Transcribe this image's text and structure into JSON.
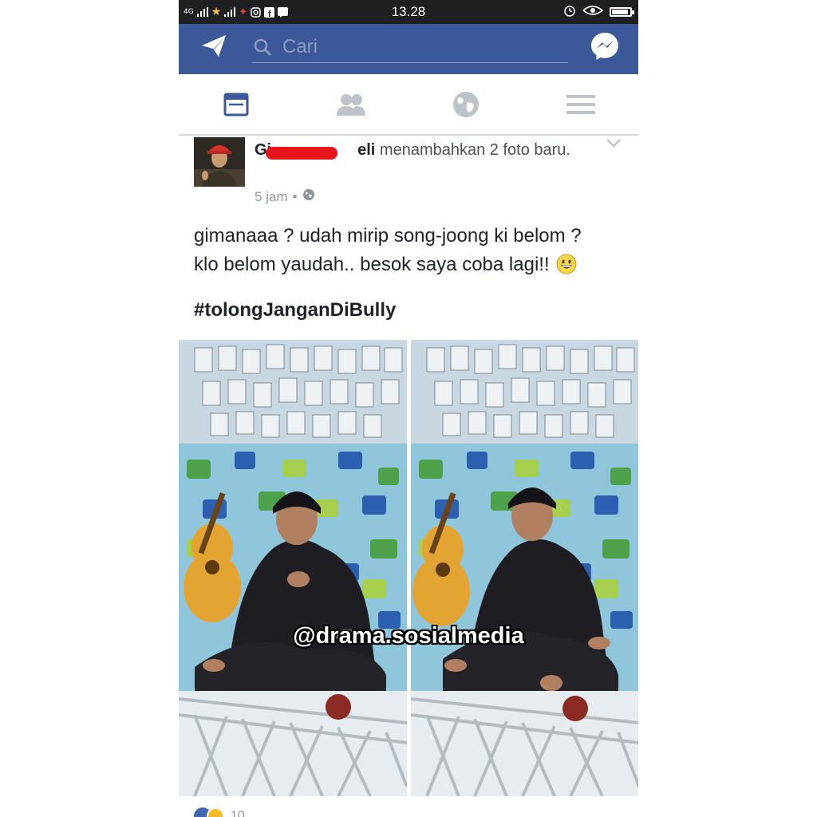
{
  "status_bar": {
    "network_label": "4G",
    "time": "13.28",
    "battery_level": 0.9
  },
  "navbar": {
    "search_placeholder": "Cari",
    "left_icon": "send-icon",
    "right_icon": "messenger-icon",
    "color": "#3b5998"
  },
  "tabs": [
    {
      "name": "news-feed",
      "icon": "newsfeed-icon",
      "active": true
    },
    {
      "name": "friends",
      "icon": "friends-icon",
      "active": false
    },
    {
      "name": "notifications",
      "icon": "globe-icon",
      "active": false
    },
    {
      "name": "menu",
      "icon": "menu-icon",
      "active": false
    }
  ],
  "post": {
    "author_visible_start": "Gi",
    "author_visible_end": "eli",
    "action": " menambahkan 2 foto baru.",
    "time": "5 jam",
    "privacy_icon": "globe-icon",
    "text_line1": "gimanaaa ? udah mirip song-joong ki belom ?",
    "text_line2": "klo belom yaudah.. besok saya coba lagi!!",
    "hashtag": "#tolongJanganDiBully",
    "watermark": "@drama.sosialmedia",
    "reaction_count": "10"
  }
}
